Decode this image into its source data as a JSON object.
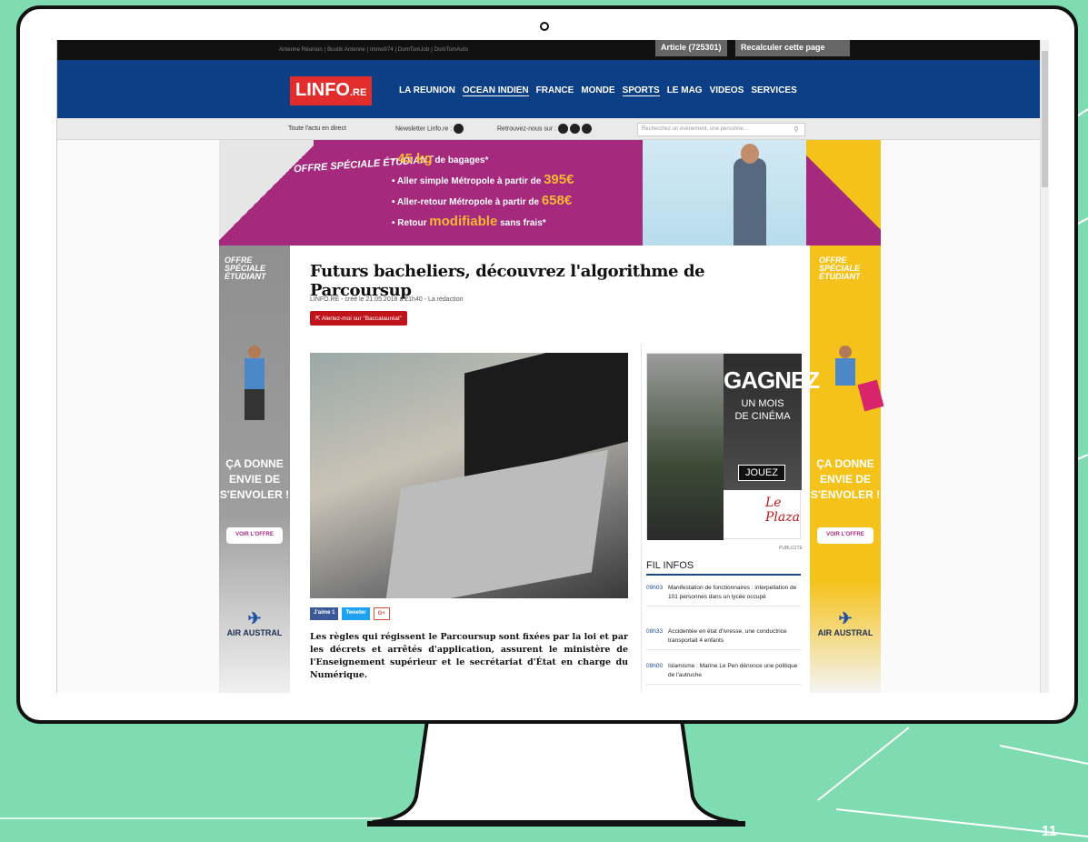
{
  "topbar": {
    "links": "Antenne Réunion | Boutik Antenne | Immo974 | DomTomJob | DomTomAuto",
    "article_btn": "Article (725301)",
    "recalc_btn": "Recalculer cette page"
  },
  "logo": {
    "main": "LINFO",
    "suffix": ".RE"
  },
  "menu": [
    "LA REUNION",
    "OCEAN INDIEN",
    "FRANCE",
    "MONDE",
    "SPORTS",
    "LE MAG",
    "VIDEOS",
    "SERVICES"
  ],
  "subbar": {
    "direct": "Toute l'actu en direct",
    "newsletter": "Newsletter Linfo.re :",
    "follow": "Retrouvez-nous sur :",
    "search_placeholder": "Recherchez un événement, une personne..."
  },
  "ad_top": {
    "tag": "OFFRE SPÉCIALE ÉTUDIANT",
    "lines": [
      {
        "big": "45 kg",
        "text": " de bagages*"
      },
      {
        "big": "395€",
        "text": "Aller simple Métropole à partir de "
      },
      {
        "big": "658€",
        "text": "Aller-retour Métropole à partir de "
      },
      {
        "big": "modifiable",
        "text": "Retour "
      }
    ],
    "line4_tail": " sans frais*"
  },
  "ad_side": {
    "tag": "OFFRE SPÉCIALE ÉTUDIANT",
    "slogan_1": "ÇA DONNE",
    "slogan_2": "ENVIE DE",
    "slogan_3": "S'ENVOLER !",
    "button": "VOIR L'OFFRE",
    "brand": "AIR AUSTRAL"
  },
  "article": {
    "title": "Futurs bacheliers, découvrez l'algorithme de Parcoursup",
    "meta": "LINFO.RE - créé le 21.05.2018 à 21h40 - La rédaction",
    "alert_btn": "Alertez-moi sur \"Baccalauréat\"",
    "share": [
      "J'aime 1",
      "Tweeter",
      "G+"
    ],
    "lead": "Les règles qui régissent le Parcoursup sont fixées par la loi et par les décrets et arrêtés d'application, assurent le ministère de l'Enseignement supérieur et le secrétariat d'État en charge du Numérique."
  },
  "cinema_ad": {
    "headline": "GAGNEZ",
    "sub1": "UN MOIS",
    "sub2": "DE CINÉMA",
    "cta": "JOUEZ",
    "brand": "Le Plaza",
    "pub": "PUBLICITE"
  },
  "fil_infos": {
    "title": "FIL INFOS",
    "items": [
      {
        "time": "09h03",
        "text": "Manifestation de fonctionnaires : interpellation de 101 personnes dans un lycée occupé"
      },
      {
        "time": "08h33",
        "text": "Accidentée en état d'ivresse, une conductrice transportait 4 enfants"
      },
      {
        "time": "08h00",
        "text": "Islamisme : Marine Le Pen dénonce une politique de l'autruche"
      }
    ]
  },
  "colors": {
    "nav": "#0d3f86",
    "brand_red": "#e32c2c",
    "ad_purple": "#a52a7e",
    "ad_yellow": "#f5c21b",
    "bg": "#7fdcb0"
  },
  "page_number": "11"
}
